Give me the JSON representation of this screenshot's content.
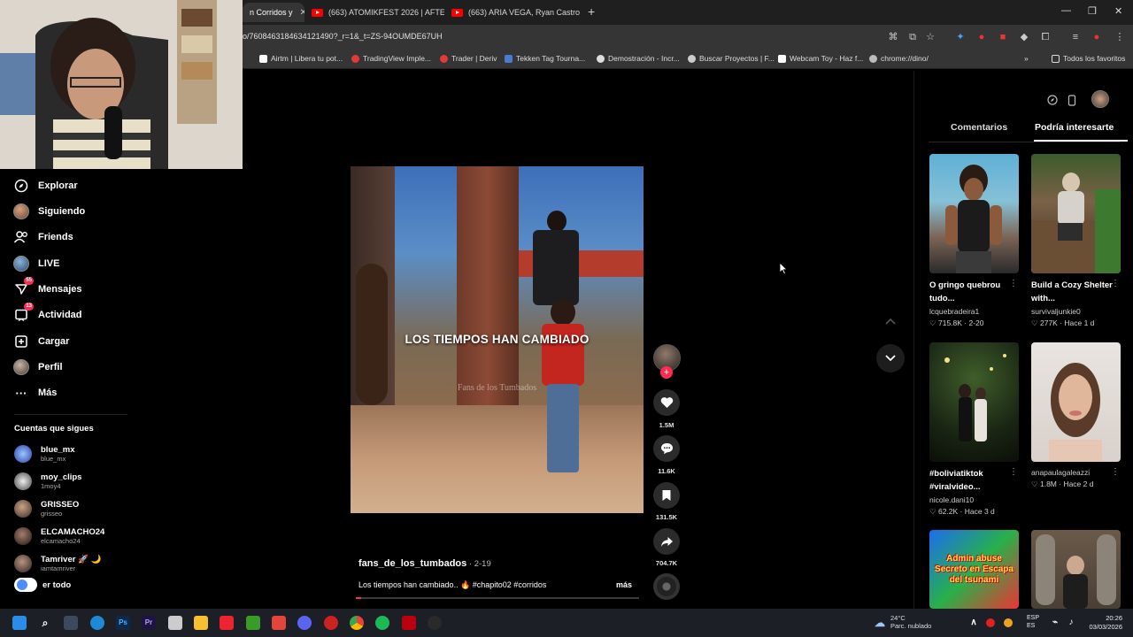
{
  "browser": {
    "tabs": [
      {
        "label": "n Corridos y",
        "active": true
      },
      {
        "label": "(663) ATOMIKFEST 2026 | AFTE",
        "active": false
      },
      {
        "label": "(663) ARIA VEGA, Ryan Castro",
        "active": false
      }
    ],
    "url": "o/7608463184634121490?_r=1&_t=ZS-94OUMDE67UH",
    "bookmarks": [
      "Airtm | Libera tu pot...",
      "TradingView Imple...",
      "Trader | Deriv",
      "Tekken Tag Tourna...",
      "Demostración - Incr...",
      "Buscar Proyectos | F...",
      "Webcam Toy - Haz f...",
      "chrome://dino/",
      "Todos los favoritos"
    ]
  },
  "sidebar": {
    "nav": [
      {
        "label": "Explorar",
        "icon": "compass-icon"
      },
      {
        "label": "Siguiendo",
        "icon": "avatar"
      },
      {
        "label": "Friends",
        "icon": "friends-icon"
      },
      {
        "label": "LIVE",
        "icon": "live-icon"
      },
      {
        "label": "Mensajes",
        "icon": "messages-icon",
        "badge": "55"
      },
      {
        "label": "Actividad",
        "icon": "activity-icon",
        "badge": "13"
      },
      {
        "label": "Cargar",
        "icon": "upload-icon"
      },
      {
        "label": "Perfil",
        "icon": "profile-icon"
      },
      {
        "label": "Más",
        "icon": "more-icon"
      }
    ],
    "following_heading": "Cuentas que sigues",
    "accounts": [
      {
        "name": "blue_mx",
        "handle": "blue_mx"
      },
      {
        "name": "moy_clips",
        "handle": "1moy4"
      },
      {
        "name": "GRISSEO",
        "handle": "grisseo"
      },
      {
        "name": "ELCAMACHO24",
        "handle": "elcamacho24"
      },
      {
        "name": "Tamriver 🚀 🌙",
        "handle": "iamtamriver"
      }
    ],
    "see_all": "er todo"
  },
  "video": {
    "caption": "LOS TIEMPOS HAN CAMBIADO",
    "watermark": "Fans de los Tumbados",
    "author": "fans_de_los_tumbados",
    "date": " · 2-19",
    "description": "Los tiempos han cambiado.. 🔥 #chapito02 #corridos",
    "more": "más",
    "progress": 0.02
  },
  "actions": {
    "likes": "1.5M",
    "comments": "11.6K",
    "saves": "131.5K",
    "shares": "704.7K"
  },
  "right_panel": {
    "tabs": [
      {
        "label": "Comentarios",
        "active": false
      },
      {
        "label": "Podría interesarte",
        "active": true
      }
    ],
    "cards": [
      {
        "title": "O gringo quebrou tudo...",
        "author": "lcquebradeira1",
        "stats": "715.8K · 2-20"
      },
      {
        "title": "Build a Cozy Shelter with...",
        "author": "survivaljunkie0",
        "stats": "277K · Hace 1 d"
      },
      {
        "title": "#boliviatiktok #viralvideo...",
        "author": "nicole.dani10",
        "stats": "62.2K · Hace 3 d"
      },
      {
        "title": "",
        "author": "anapaulagaleazzi",
        "stats": "1.8M · Hace 2 d"
      },
      {
        "title": "",
        "author": "",
        "stats": "",
        "thumb_text": "Admin abuse Secreto en Escapa del tsunami"
      },
      {
        "title": "",
        "author": "",
        "stats": ""
      }
    ]
  },
  "taskbar": {
    "weather_temp": "24°C",
    "weather_desc": "Parc. nublado",
    "lang": "ESP",
    "lang_sub": "ES",
    "time": "20:26",
    "date": "03/03/2026"
  },
  "colors": {
    "accent": "#fe2c55",
    "background": "#000000",
    "chrome": "#353535"
  }
}
